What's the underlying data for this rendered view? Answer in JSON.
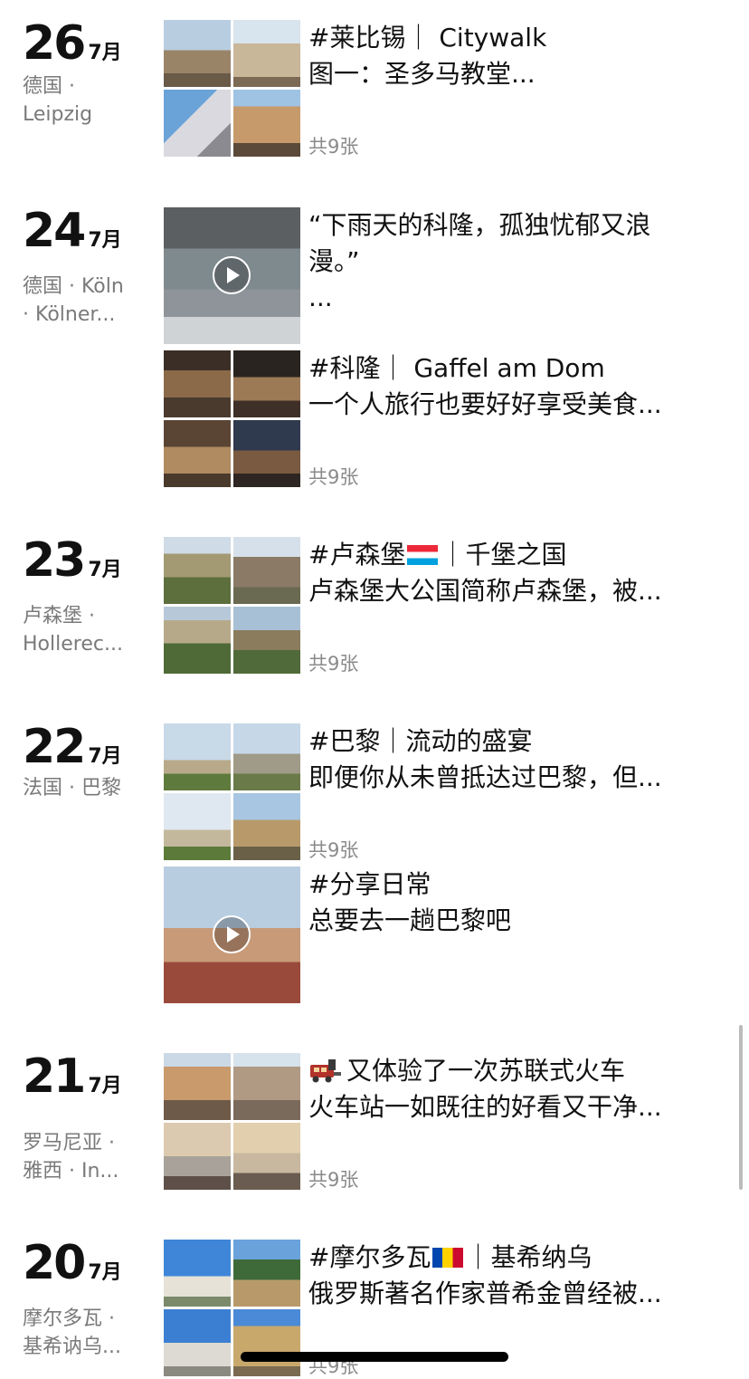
{
  "days": [
    {
      "day": "26",
      "month": "7月",
      "location": [
        "德国 ·",
        "Leipzig"
      ],
      "posts": [
        {
          "lines": [
            "#莱比锡｜ Citywalk",
            "图一：圣多马教堂..."
          ],
          "count": "共9张"
        }
      ]
    },
    {
      "day": "24",
      "month": "7月",
      "location": [
        "德国 · Köln",
        "· Kölner..."
      ],
      "posts": [
        {
          "lines": [
            "“下雨天的科隆，孤独忧郁又浪",
            "漫。”",
            "..."
          ],
          "video": true
        },
        {
          "lines": [
            "#科隆｜ Gaffel am Dom",
            "一个人旅行也要好好享受美食..."
          ],
          "count": "共9张"
        }
      ]
    },
    {
      "day": "23",
      "month": "7月",
      "location": [
        "卢森堡 ·",
        "Hollerec..."
      ],
      "posts": [
        {
          "lines": [
            "#卢森堡",
            "｜千堡之国",
            "卢森堡大公国简称卢森堡，被..."
          ],
          "count": "共9张",
          "flag": "lu"
        }
      ]
    },
    {
      "day": "22",
      "month": "7月",
      "location": [
        "法国 · 巴黎"
      ],
      "posts": [
        {
          "lines": [
            "#巴黎｜流动的盛宴",
            "即便你从未曾抵达过巴黎，但..."
          ],
          "count": "共9张"
        },
        {
          "lines": [
            "#分享日常",
            "总要去一趟巴黎吧"
          ],
          "video": true
        }
      ]
    },
    {
      "day": "21",
      "month": "7月",
      "location": [
        "罗马尼亚 ·",
        "雅西 · In..."
      ],
      "posts": [
        {
          "lines": [
            "又体验了一次苏联式火车",
            "火车站一如既往的好看又干净..."
          ],
          "count": "共9张",
          "emoji": "train-icon"
        }
      ]
    },
    {
      "day": "20",
      "month": "7月",
      "location": [
        "摩尔多瓦 ·",
        "基希讷乌..."
      ],
      "posts": [
        {
          "lines": [
            "#摩尔多瓦",
            "｜基希纳乌",
            "俄罗斯著名作家普希金曾经被..."
          ],
          "count": "共9张",
          "flag": "md"
        }
      ]
    }
  ],
  "colors": {
    "text": "#111111",
    "secondary": "#7a7a7a",
    "background": "#ffffff"
  }
}
